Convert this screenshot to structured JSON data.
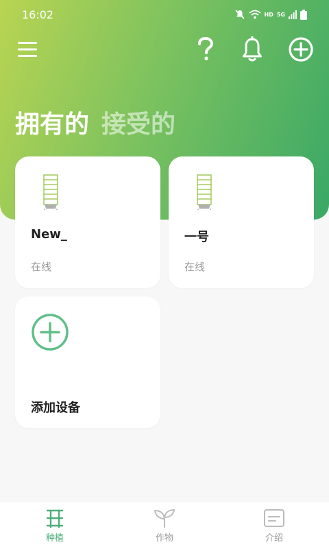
{
  "status_bar": {
    "time": "16:02",
    "hd": "HD",
    "network": "5G"
  },
  "tabs": [
    {
      "label": "拥有的",
      "active": true
    },
    {
      "label": "接受的",
      "active": false
    }
  ],
  "devices": [
    {
      "name": "New_",
      "status": "在线"
    },
    {
      "name": "一号",
      "status": "在线"
    }
  ],
  "add_device": {
    "label": "添加设备"
  },
  "bottom_nav": [
    {
      "label": "种植",
      "icon": "planting-rack-icon",
      "active": true
    },
    {
      "label": "作物",
      "icon": "sprout-icon",
      "active": false
    },
    {
      "label": "介绍",
      "icon": "info-card-icon",
      "active": false
    }
  ],
  "colors": {
    "accent": "#4caf7a",
    "gradient_start": "#b9d452",
    "gradient_end": "#3aa866"
  }
}
